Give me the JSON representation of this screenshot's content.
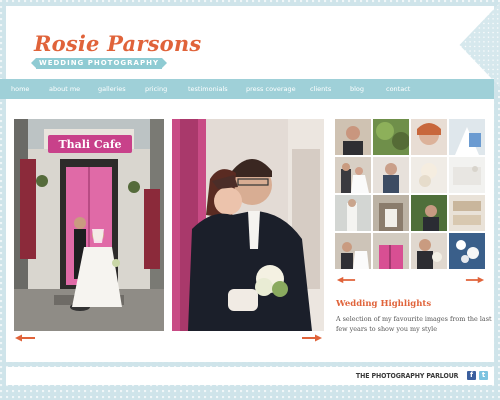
{
  "brand": {
    "name": "Rosie Parsons",
    "tagline": "WEDDING PHOTOGRAPHY"
  },
  "nav": {
    "items": [
      {
        "label": "home"
      },
      {
        "label": "about me"
      },
      {
        "label": "galleries"
      },
      {
        "label": "pricing"
      },
      {
        "label": "testimonials"
      },
      {
        "label": "press coverage"
      },
      {
        "label": "clients"
      },
      {
        "label": "blog"
      },
      {
        "label": "contact"
      }
    ]
  },
  "photos": {
    "left_sign": "Thali Cafe"
  },
  "highlights": {
    "title": "Wedding Highlights",
    "text": "A selection of my favourite images from the last few years to show you my style"
  },
  "footer": {
    "brand": "THE PHOTOGRAPHY PARLOUR",
    "facebook_icon": "f",
    "twitter_icon": "t"
  },
  "colors": {
    "accent": "#e0633a",
    "nav_bg": "#9fd0d8",
    "page_bg": "#cfe4ea"
  }
}
